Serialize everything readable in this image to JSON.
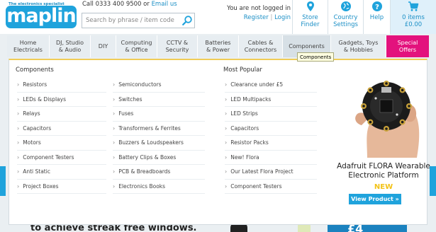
{
  "header": {
    "logo_tagline": "The electronics specialist",
    "logo_text": "maplin",
    "phone_text": "Call 0333 400 9500 or",
    "email_link": "Email us",
    "search_placeholder": "Search by phrase / item code",
    "login_status": "You are not logged in",
    "register_link": "Register",
    "separator": "|",
    "login_link": "Login",
    "store_finder": [
      "Store",
      "Finder"
    ],
    "country_settings": [
      "Country",
      "Settings"
    ],
    "help": "Help",
    "basket_items": "0 items",
    "basket_total": "£0.00"
  },
  "nav": {
    "items": [
      {
        "label": [
          "Home",
          "Electricals"
        ]
      },
      {
        "label": [
          "DJ, Studio",
          "& Audio"
        ]
      },
      {
        "label": [
          "DIY"
        ]
      },
      {
        "label": [
          "Computing",
          "& Office"
        ]
      },
      {
        "label": [
          "CCTV &",
          "Security"
        ]
      },
      {
        "label": [
          "Batteries",
          "& Power"
        ]
      },
      {
        "label": [
          "Cables &",
          "Connectors"
        ]
      },
      {
        "label": [
          "Components"
        ]
      },
      {
        "label": [
          "Gadgets, Toys",
          "& Hobbies"
        ]
      },
      {
        "label": [
          "Special",
          "Offers"
        ]
      }
    ],
    "tooltip": "Components"
  },
  "menu": {
    "components_title": "Components",
    "components_col1": [
      "Resistors",
      "LEDs & Displays",
      "Relays",
      "Capacitors",
      "Motors",
      "Component Testers",
      "Anti Static",
      "Project Boxes"
    ],
    "components_col2": [
      "Semiconductors",
      "Switches",
      "Fuses",
      "Transformers & Ferrites",
      "Buzzers & Loudspeakers",
      "Battery Clips & Boxes",
      "PCB & Breadboards",
      "Electronics Books"
    ],
    "popular_title": "Most Popular",
    "popular": [
      "Clearance under £5",
      "LED Multipacks",
      "LED Strips",
      "Capacitors",
      "Resistor Packs",
      "New! Flora",
      "Our Latest Flora Project",
      "Component Testers"
    ],
    "promo": {
      "title_line1": "Adafruit FLORA Wearable",
      "title_line2": "Electronic Platform",
      "badge": "NEW",
      "button": "View Product »"
    }
  },
  "background": {
    "headline": "to achieve streak free windows.",
    "price": "£4"
  },
  "colors": {
    "brand_blue": "#1fa3dc",
    "link_blue": "#1b8fc6",
    "special_pink": "#e3127d",
    "menu_accent": "#f0cc56",
    "new_badge": "#f3c318"
  },
  "icons": {
    "search": "search-icon",
    "store": "map-pin-icon",
    "country": "globe-icon",
    "help": "question-icon",
    "basket": "basket-icon",
    "arrow": "chevron-right-icon"
  }
}
